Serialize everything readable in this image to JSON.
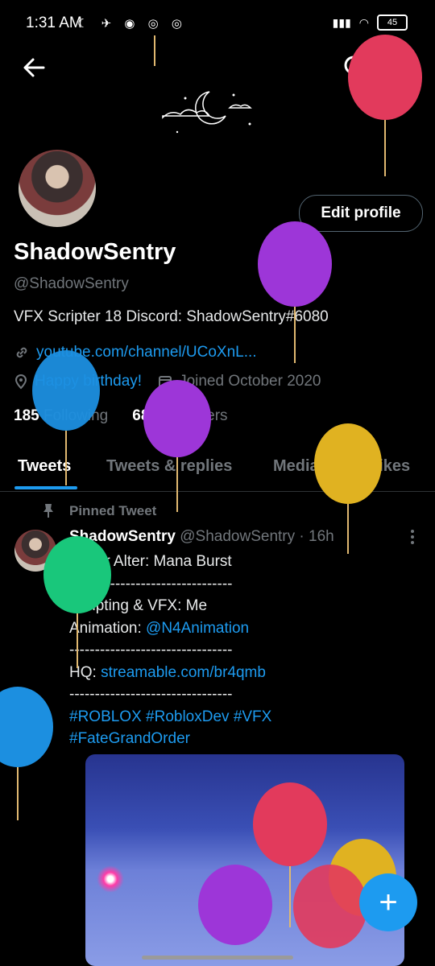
{
  "status_bar": {
    "time": "1:31 AM",
    "battery": "45"
  },
  "profile": {
    "edit_label": "Edit profile",
    "name": "ShadowSentry",
    "handle": "@ShadowSentry",
    "bio": "VFX Scripter 18 Discord: ShadowSentry#6080",
    "link": "youtube.com/channel/UCoXnL...",
    "birthday": "Happy birthday!",
    "joined": "Joined October 2020",
    "following_count": "185",
    "following_label": "Following",
    "followers_count": "683",
    "followers_label": "Followers"
  },
  "tabs": [
    "Tweets",
    "Tweets & replies",
    "Media",
    "Likes"
  ],
  "tweet": {
    "pinned_label": "Pinned Tweet",
    "author_name": "ShadowSentry",
    "author_meta": "@ShadowSentry · 16h",
    "line1": "Saber Alter: Mana Burst",
    "divider": "--------------------------------",
    "line3": "Scripting & VFX: Me",
    "line4_prefix": "Animation: ",
    "line4_link": "@N4Animation",
    "line6_prefix": "HQ: ",
    "line6_link": "streamable.com/br4qmb",
    "hashtags1": "#ROBLOX #RobloxDev #VFX",
    "hashtags2": "#FateGrandOrder"
  },
  "colors": {
    "accent": "#1d9bf0",
    "background": "#000000",
    "muted": "#71767b"
  },
  "icons": [
    "back-arrow-icon",
    "search-icon",
    "more-vertical-icon",
    "link-icon",
    "location-icon",
    "calendar-icon",
    "pin-icon",
    "plus-icon"
  ]
}
